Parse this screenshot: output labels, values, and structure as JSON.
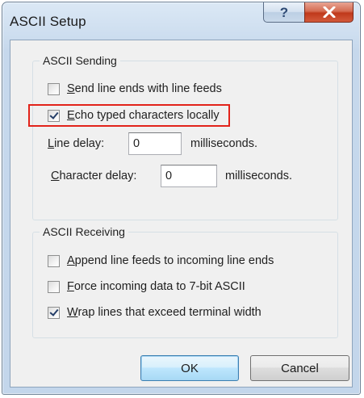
{
  "window": {
    "title": "ASCII Setup",
    "help_glyph": "?",
    "close_glyph": "close-icon"
  },
  "sending": {
    "legend": "ASCII Sending",
    "send_line_ends": {
      "prefix": "",
      "mnemonic": "S",
      "rest": "end line ends with line feeds",
      "checked": false
    },
    "echo_typed": {
      "prefix": "",
      "mnemonic": "E",
      "rest": "cho typed characters locally",
      "checked": true
    },
    "line_delay": {
      "mnemonic": "L",
      "rest": "ine delay:",
      "value": "0",
      "units": "milliseconds."
    },
    "char_delay": {
      "mnemonic": "C",
      "rest": "haracter delay:",
      "value": "0",
      "units": "milliseconds."
    }
  },
  "receiving": {
    "legend": "ASCII Receiving",
    "append_line_feeds": {
      "mnemonic": "A",
      "rest": "ppend line feeds to incoming line ends",
      "checked": false
    },
    "force_7bit": {
      "mnemonic": "F",
      "rest": "orce incoming data to 7-bit ASCII",
      "checked": false
    },
    "wrap_lines": {
      "mnemonic": "W",
      "rest": "rap lines that exceed terminal width",
      "checked": true
    }
  },
  "buttons": {
    "ok": "OK",
    "cancel": "Cancel"
  },
  "colors": {
    "highlight_border": "#e2231a",
    "close_button": "#c0391b",
    "default_button_border": "#3c7fb1"
  }
}
